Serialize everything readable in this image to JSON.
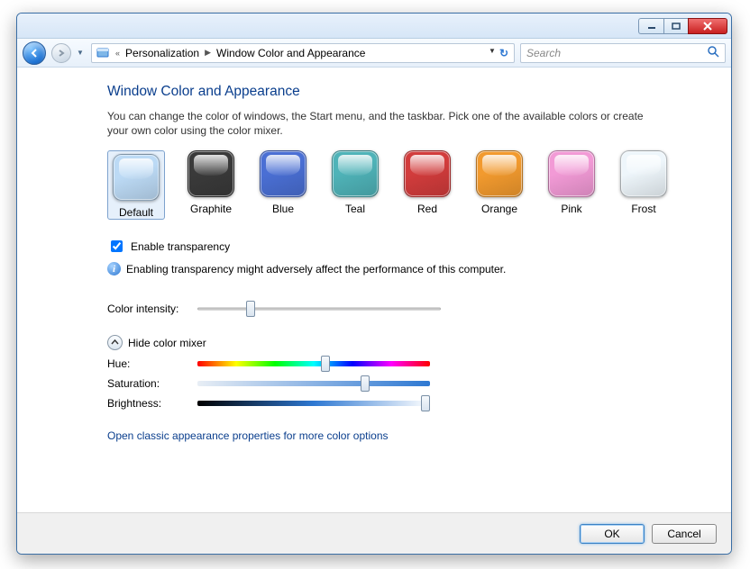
{
  "breadcrumb": {
    "parent": "Personalization",
    "current": "Window Color and Appearance"
  },
  "search": {
    "placeholder": "Search"
  },
  "page": {
    "title": "Window Color and Appearance",
    "description": "You can change the color of windows, the Start menu, and the taskbar. Pick one of the available colors or create your own color using the color mixer."
  },
  "swatches": [
    {
      "name": "Default",
      "color": "#bcdaf5",
      "selected": true
    },
    {
      "name": "Graphite",
      "color": "#3a3a3a",
      "selected": false
    },
    {
      "name": "Blue",
      "color": "#4a6fd4",
      "selected": false
    },
    {
      "name": "Teal",
      "color": "#4fb3b8",
      "selected": false
    },
    {
      "name": "Red",
      "color": "#d23c3c",
      "selected": false
    },
    {
      "name": "Orange",
      "color": "#f29a2e",
      "selected": false
    },
    {
      "name": "Pink",
      "color": "#f29ad6",
      "selected": false
    },
    {
      "name": "Frost",
      "color": "#eef6fb",
      "selected": false
    }
  ],
  "transparency": {
    "label": "Enable transparency",
    "checked": true,
    "warning": "Enabling transparency might adversely affect the performance of this computer."
  },
  "intensity": {
    "label": "Color intensity:",
    "value": 22
  },
  "mixer": {
    "toggle_label": "Hide color mixer",
    "hue": {
      "label": "Hue:",
      "value": 55
    },
    "saturation": {
      "label": "Saturation:",
      "value": 72
    },
    "brightness": {
      "label": "Brightness:",
      "value": 98
    }
  },
  "classic_link": "Open classic appearance properties for more color options",
  "buttons": {
    "ok": "OK",
    "cancel": "Cancel"
  }
}
